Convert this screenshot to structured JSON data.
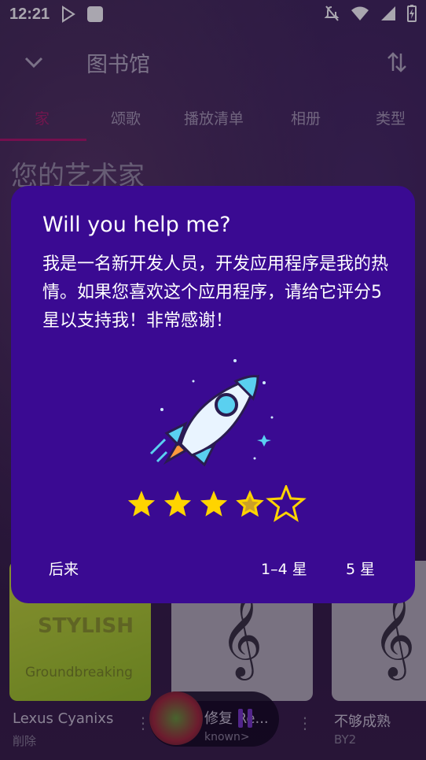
{
  "status_bar": {
    "time": "12:21"
  },
  "app_bar": {
    "title": "图书馆"
  },
  "tabs": [
    "家",
    "颂歌",
    "播放清单",
    "相册",
    "类型"
  ],
  "section_title": "您的艺术家",
  "cards": [
    {
      "title": "Lexus Cyanixs",
      "subtitle": "削除",
      "art_top": "STYLISH",
      "art_bottom": "Groundbreaking"
    },
    {
      "title": "",
      "subtitle": ""
    },
    {
      "title": "不够成熟",
      "subtitle": "BY2"
    }
  ],
  "mini_player": {
    "title": "修复 Re...",
    "subtitle": "known>"
  },
  "dialog": {
    "title": "Will you help me?",
    "body": "我是一名新开发人员，开发应用程序是我的热情。如果您喜欢这个应用程序，请给它评分5星以支持我！非常感谢！",
    "rating_stars": 3.5,
    "btn_later": "后来",
    "btn_low": "1–4 星",
    "btn_five": "5 星"
  },
  "colors": {
    "dialog_bg": "#3a0a92",
    "star": "#ffd400",
    "tab_indicator": "#b0176a"
  }
}
